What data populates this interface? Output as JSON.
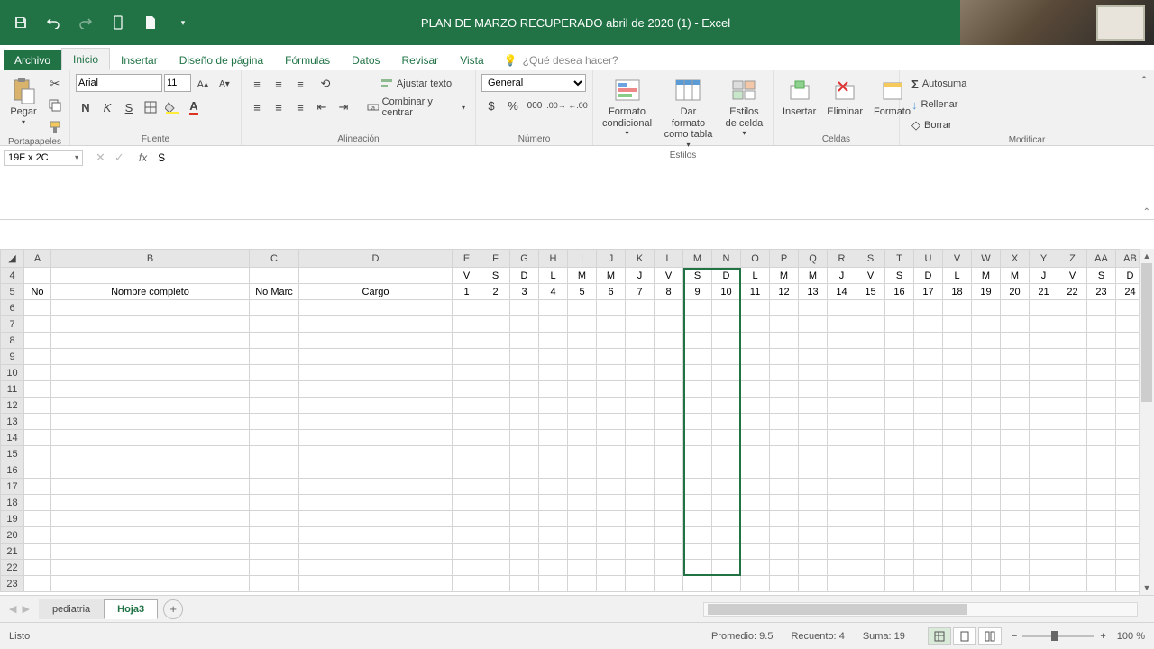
{
  "titlebar": {
    "title": "PLAN DE MARZO RECUPERADO abril de 2020 (1) - Excel"
  },
  "menus": {
    "file": "Archivo",
    "tabs": [
      "Inicio",
      "Insertar",
      "Diseño de página",
      "Fórmulas",
      "Datos",
      "Revisar",
      "Vista"
    ],
    "active": "Inicio",
    "tellme": "¿Qué desea hacer?"
  },
  "ribbon": {
    "clipboard": {
      "label": "Portapapeles",
      "paste": "Pegar"
    },
    "font": {
      "label": "Fuente",
      "name": "Arial",
      "size": "11"
    },
    "alignment": {
      "label": "Alineación",
      "wrap": "Ajustar texto",
      "merge": "Combinar y centrar"
    },
    "number": {
      "label": "Número",
      "format": "General"
    },
    "styles": {
      "label": "Estilos",
      "cond": "Formato condicional",
      "table": "Dar formato como tabla",
      "cell": "Estilos de celda"
    },
    "cells": {
      "label": "Celdas",
      "insert": "Insertar",
      "delete": "Eliminar",
      "format": "Formato"
    },
    "editing": {
      "label": "Modificar",
      "autosum": "Autosuma",
      "fill": "Rellenar",
      "clear": "Borrar"
    }
  },
  "namebox": "19F x 2C",
  "formula": "S",
  "grid": {
    "cols": [
      "A",
      "B",
      "C",
      "D",
      "E",
      "F",
      "G",
      "H",
      "I",
      "J",
      "K",
      "L",
      "M",
      "N",
      "O",
      "P",
      "Q",
      "R",
      "S",
      "T",
      "U",
      "V",
      "W",
      "X",
      "Y",
      "Z",
      "AA",
      "AB"
    ],
    "row4": [
      "",
      "",
      "",
      "",
      "V",
      "S",
      "D",
      "L",
      "M",
      "M",
      "J",
      "V",
      "S",
      "D",
      "L",
      "M",
      "M",
      "J",
      "V",
      "S",
      "D",
      "L",
      "M",
      "M",
      "J",
      "V",
      "S",
      "D"
    ],
    "row5_labels": {
      "A": "No",
      "B": "Nombre completo",
      "C": "No Marc",
      "D": "Cargo"
    },
    "row5_days": [
      "1",
      "2",
      "3",
      "4",
      "5",
      "6",
      "7",
      "8",
      "9",
      "10",
      "11",
      "12",
      "13",
      "14",
      "15",
      "16",
      "17",
      "18",
      "19",
      "20",
      "21",
      "22",
      "23",
      "24"
    ],
    "weekend_cols": [
      "F",
      "G"
    ],
    "selected_cols": [
      "M",
      "N"
    ],
    "first_row": 4,
    "last_row": 23
  },
  "sheettabs": {
    "tabs": [
      "pediatria",
      "Hoja3"
    ],
    "active": "Hoja3"
  },
  "statusbar": {
    "mode": "Listo",
    "avg_label": "Promedio:",
    "avg": "9.5",
    "count_label": "Recuento:",
    "count": "4",
    "sum_label": "Suma:",
    "sum": "19",
    "zoom": "100 %"
  }
}
